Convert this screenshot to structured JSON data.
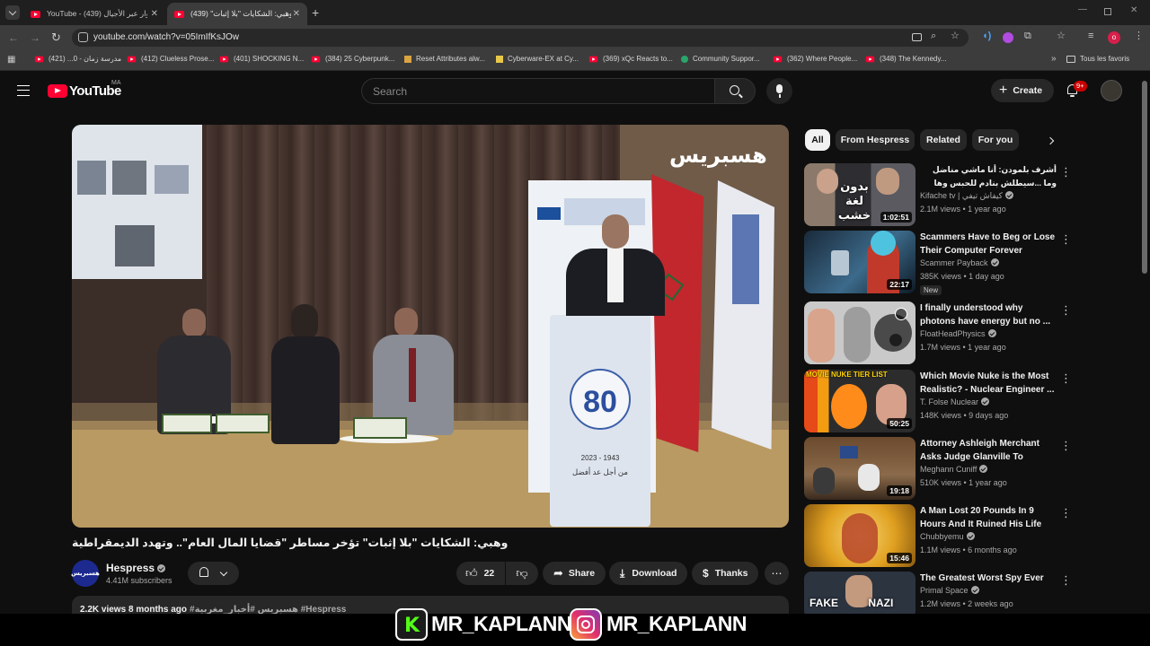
{
  "browser": {
    "tabs": [
      {
        "label": "YouTube - حوار عبر الأجيال (439)",
        "active": false
      },
      {
        "label": "وهبي: الشكايات \"بلا إثبات\" (439)",
        "active": true
      }
    ],
    "url": "youtube.com/watch?v=05ImIfKsJOw",
    "bookmarks": [
      {
        "label": "مدرسة زمان - 0... (421)",
        "icon": "youtube-icon"
      },
      {
        "label": "(412) Clueless Prose...",
        "icon": "youtube-icon"
      },
      {
        "label": "(401) SHOCKING N...",
        "icon": "youtube-icon"
      },
      {
        "label": "(384) 25 Cyberpunk...",
        "icon": "youtube-icon"
      },
      {
        "label": "Reset Attributes alw...",
        "icon": "page-icon"
      },
      {
        "label": "Cyberware-EX at Cy...",
        "icon": "page-icon"
      },
      {
        "label": "(369) xQc Reacts to...",
        "icon": "youtube-icon"
      },
      {
        "label": "Community Suppor...",
        "icon": "page-icon"
      },
      {
        "label": "(362) Where People...",
        "icon": "youtube-icon"
      },
      {
        "label": "(348) The Kennedy...",
        "icon": "youtube-icon"
      }
    ],
    "all_bookmarks_label": "Tous les favoris"
  },
  "youtube": {
    "logo": "YouTube",
    "region": "MA",
    "search_placeholder": "Search",
    "create_label": "Create",
    "notif_badge": "9+",
    "filters": [
      "All",
      "From Hespress",
      "Related",
      "For you"
    ],
    "video": {
      "watermark": "هسبريس",
      "title": "وهبي: الشكايات \"بلا إثبات\" تؤخر مساطر \"قضايا المال العام\".. وتهدد الديمقراطية",
      "channel": "Hespress",
      "subscribers": "4.41M subscribers",
      "likes": "22",
      "share_label": "Share",
      "download_label": "Download",
      "thanks_label": "Thanks",
      "views": "2.2K views",
      "age": "8 months ago",
      "tags": "#هسبريس #أخبار_مغربية #Hespress",
      "podium_number": "80",
      "podium_years": "2023 - 1943",
      "podium_text": "من أجل عد أفضل"
    },
    "sidebar": [
      {
        "title": "أشرف بلمودن: أنا ماشي مناضل وما ...سيطلش بنادم للحبس وها شنو درت قضية",
        "channel": "Kifache tv | كيفاش تيفي",
        "meta": "2.1M views • 1 year ago",
        "duration": "1:02:51",
        "thumb_text": "بدون لغة خشب",
        "badge": ""
      },
      {
        "title": "Scammers Have to Beg or Lose Their Computer Forever",
        "channel": "Scammer Payback",
        "meta": "385K views • 1 day ago",
        "duration": "22:17",
        "thumb_text": "",
        "badge": "New"
      },
      {
        "title": "I finally understood why photons have energy but no ...",
        "channel": "FloatHeadPhysics",
        "meta": "1.7M views • 1 year ago",
        "duration": "",
        "thumb_text": "",
        "badge": ""
      },
      {
        "title": "Which Movie Nuke is the Most Realistic? - Nuclear Engineer ...",
        "channel": "T. Folse Nuclear",
        "meta": "148K views • 9 days ago",
        "duration": "50:25",
        "thumb_text": "MOVIE NUKE TIER LIST",
        "badge": ""
      },
      {
        "title": "Attorney Ashleigh Merchant Asks Judge Glanville To Recus...",
        "channel": "Meghann Cuniff",
        "meta": "510K views • 1 year ago",
        "duration": "19:18",
        "thumb_text": "",
        "badge": ""
      },
      {
        "title": "A Man Lost 20 Pounds In 9 Hours And It Ruined His Life",
        "channel": "Chubbyemu",
        "meta": "1.1M views • 6 months ago",
        "duration": "15:46",
        "thumb_text": "",
        "badge": ""
      },
      {
        "title": "The Greatest Worst Spy Ever",
        "channel": "Primal Space",
        "meta": "1.2M views • 2 weeks ago",
        "duration": "",
        "thumb_text": "FAKE NAZI",
        "badge": ""
      }
    ]
  },
  "overlay": {
    "handle1": "MR_KAPLANN",
    "handle2": "MR_KAPLANN",
    "icon1": "kick-icon",
    "icon2": "instagram-icon"
  },
  "colors": {
    "youtube_red": "#ff0033",
    "kick_green": "#53fc18",
    "bg": "#0f0f0f"
  }
}
